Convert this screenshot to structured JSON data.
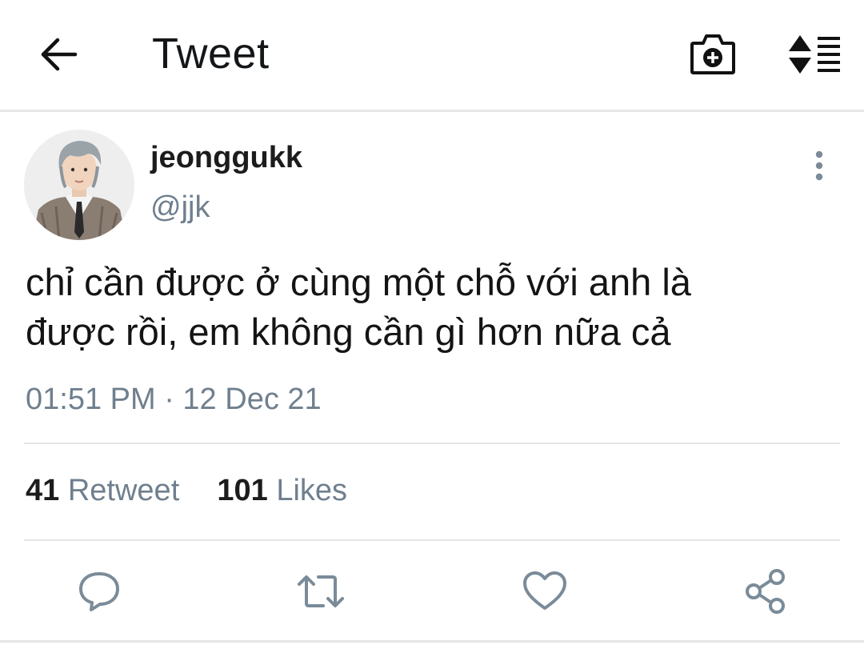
{
  "header": {
    "title": "Tweet",
    "icons": [
      "back-arrow-icon",
      "camera-add-icon",
      "sort-list-icon"
    ]
  },
  "tweet": {
    "display_name": "jeonggukk",
    "handle": "@jjk",
    "text": "chỉ cần được ở cùng một chỗ với anh là\nđược rồi, em không cần gì hơn nữa cả",
    "timestamp": "01:51 PM · 12 Dec 21",
    "retweets_count": "41",
    "retweets_label": "Retweet",
    "likes_count": "101",
    "likes_label": "Likes"
  },
  "actions": [
    "reply-icon",
    "retweet-icon",
    "like-icon",
    "share-icon"
  ],
  "colors": {
    "text_primary": "#14171a",
    "text_secondary": "#6f7f8e",
    "icon_gray": "#7a8b99",
    "divider": "#e4e6e8"
  }
}
